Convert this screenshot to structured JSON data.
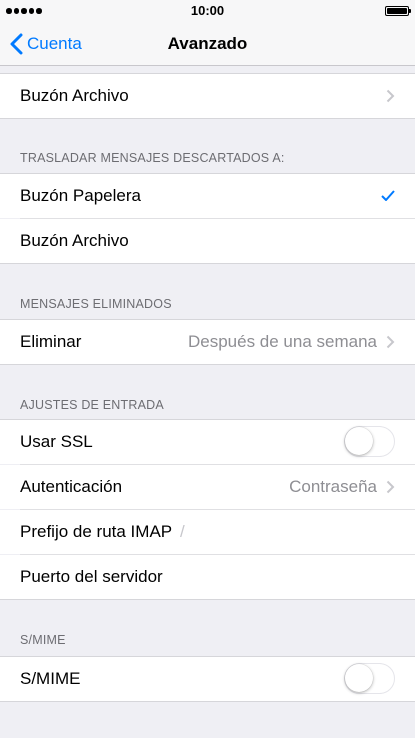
{
  "status": {
    "time": "10:00"
  },
  "nav": {
    "back_label": "Cuenta",
    "title": "Avanzado"
  },
  "top_row": {
    "label": "Buzón Archivo"
  },
  "sections": {
    "discard": {
      "header": "TRASLADAR MENSAJES DESCARTADOS A:",
      "items": [
        {
          "label": "Buzón Papelera",
          "selected": true
        },
        {
          "label": "Buzón Archivo",
          "selected": false
        }
      ]
    },
    "deleted": {
      "header": "MENSAJES ELIMINADOS",
      "row": {
        "label": "Eliminar",
        "value": "Después de una semana"
      }
    },
    "incoming": {
      "header": "AJUSTES DE ENTRADA",
      "ssl": {
        "label": "Usar SSL",
        "on": false
      },
      "auth": {
        "label": "Autenticación",
        "value": "Contraseña"
      },
      "imap": {
        "label": "Prefijo de ruta IMAP",
        "value": "/"
      },
      "port": {
        "label": "Puerto del servidor"
      }
    },
    "smime": {
      "header": "S/MIME",
      "row": {
        "label": "S/MIME",
        "on": false
      }
    }
  },
  "colors": {
    "accent": "#007aff",
    "background": "#efeff4"
  }
}
